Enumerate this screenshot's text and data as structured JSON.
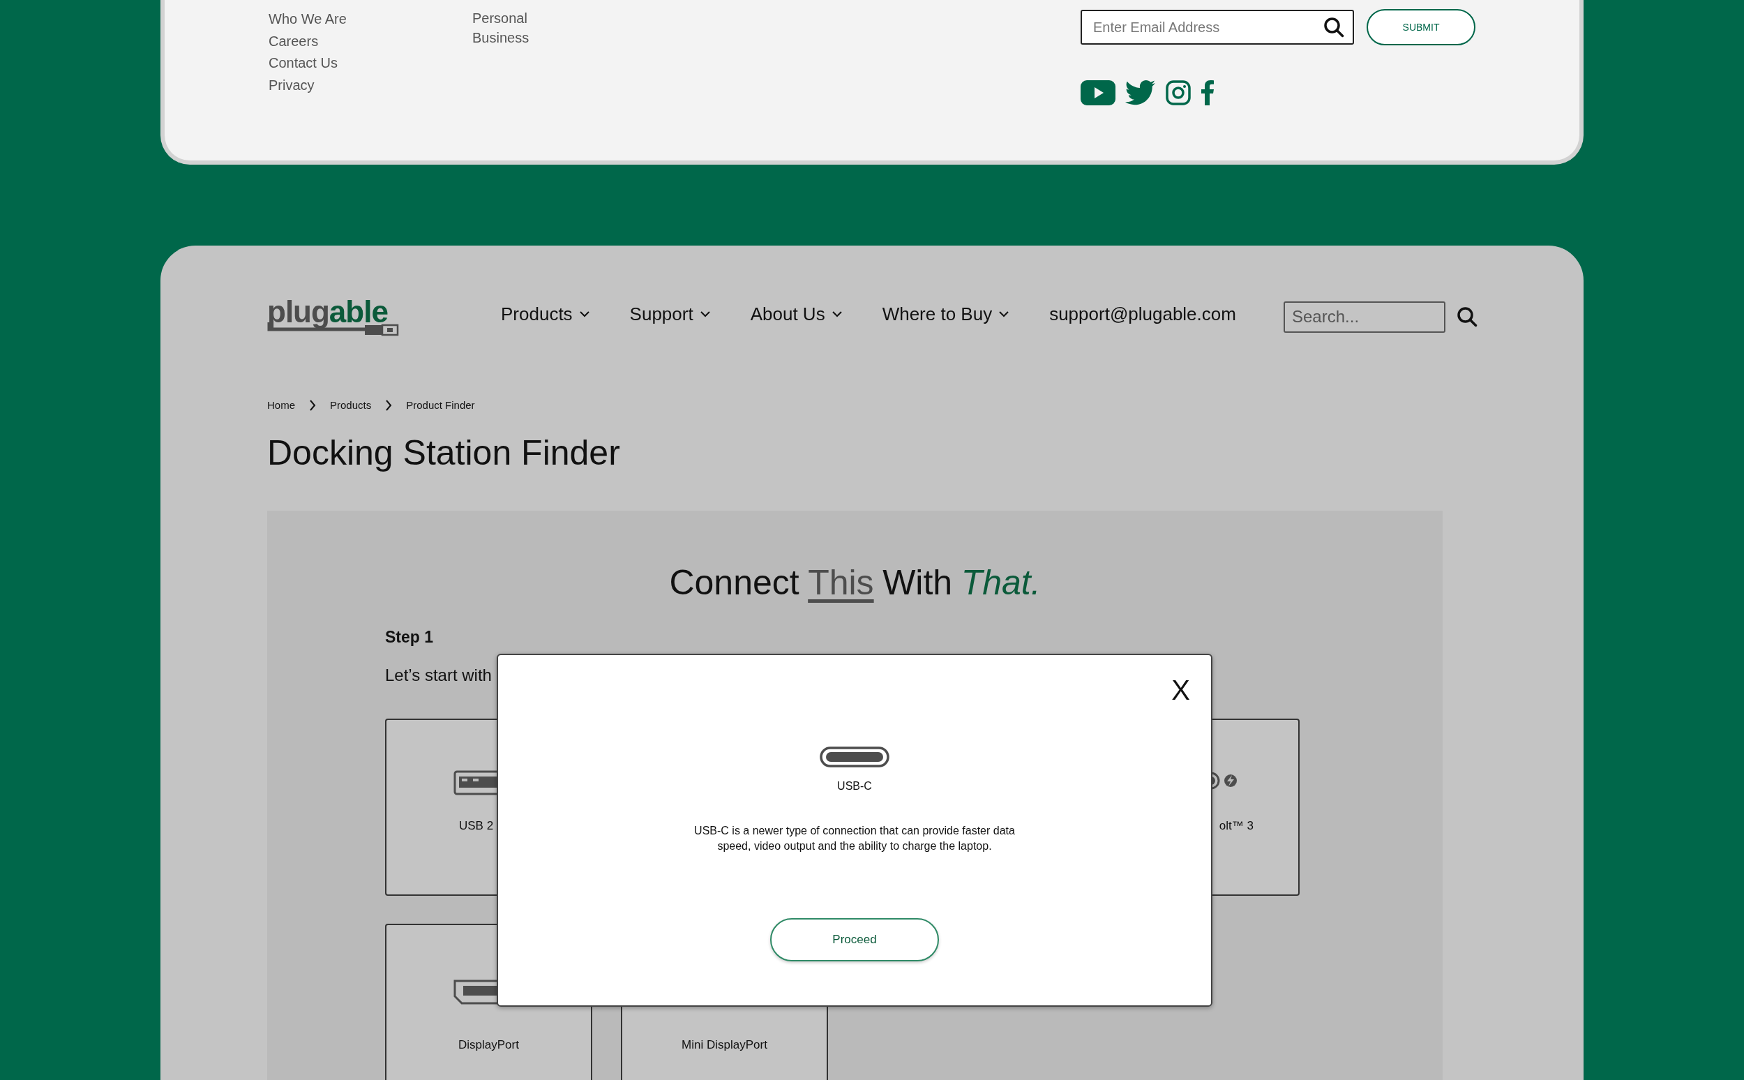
{
  "footer": {
    "links_1": [
      "Who We Are",
      "Careers",
      "Contact Us",
      "Privacy"
    ],
    "links_2": [
      "Personal",
      "Business"
    ],
    "newsletter": {
      "placeholder": "Enter Email Address",
      "button": "SUBMIT"
    },
    "social": [
      {
        "kind": "youtube"
      },
      {
        "kind": "twitter"
      },
      {
        "kind": "instagram"
      },
      {
        "kind": "facebook"
      }
    ]
  },
  "header": {
    "logo": {
      "first": "plug",
      "second": "able"
    },
    "nav": [
      {
        "label": "Products",
        "dropdown": true
      },
      {
        "label": "Support",
        "dropdown": true
      },
      {
        "label": "About Us",
        "dropdown": true
      },
      {
        "label": "Where to Buy",
        "dropdown": true
      },
      {
        "label": "support@plugable.com",
        "dropdown": false
      }
    ],
    "search": {
      "placeholder": "Search..."
    }
  },
  "breadcrumb": [
    "Home",
    "Products",
    "Product Finder"
  ],
  "title": "Docking Station Finder",
  "finder": {
    "heading": [
      {
        "text": "Connect",
        "kind": "plain"
      },
      {
        "text": "This",
        "kind": "underlined"
      },
      {
        "text": "With",
        "kind": "plain"
      },
      {
        "text": "That.",
        "kind": "accent"
      }
    ],
    "step": "Step 1",
    "prompt": "Let’s start with",
    "row_1": [
      {
        "label": "USB 2",
        "kind": "usb-a"
      },
      {
        "label": "olt™ 3",
        "kind": "thunderbolt"
      }
    ],
    "row_2": [
      {
        "label": "DisplayPort",
        "kind": "displayport"
      },
      {
        "label": "Mini DisplayPort",
        "kind": "none"
      }
    ]
  },
  "modal": {
    "close": "X",
    "port": "USB-C",
    "description": "USB-C is a newer type of connection that can provide faster data speed, video output and the ability to charge the laptop.",
    "button": "Proceed"
  }
}
